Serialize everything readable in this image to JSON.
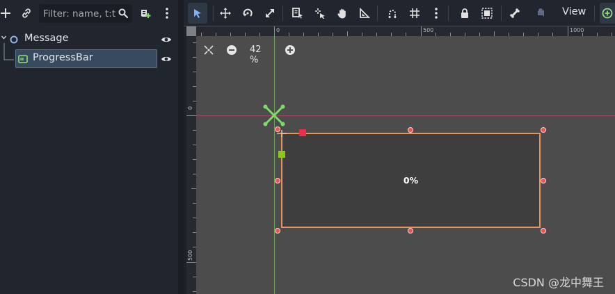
{
  "scene_dock": {
    "filter_placeholder": "Filter: name, t:t",
    "nodes": [
      {
        "label": "Message",
        "icon": "control-node-icon",
        "visible": true
      },
      {
        "label": "ProgressBar",
        "icon": "progressbar-node-icon",
        "visible": true,
        "selected": true
      }
    ]
  },
  "toolbar": {
    "view_label": "View"
  },
  "viewport": {
    "zoom_label": "42 %",
    "ruler_top": [
      "0",
      "500",
      "1000"
    ],
    "ruler_left": [
      "0",
      "500"
    ],
    "progress_text": "0%"
  },
  "watermark": "CSDN @龙中舞王",
  "colors": {
    "accent_select": "#e5945c",
    "handle": "#ef5350",
    "anchor_green": "#7ddb68",
    "guide_red": "#b0476a",
    "guide_green": "#6ea05a"
  }
}
